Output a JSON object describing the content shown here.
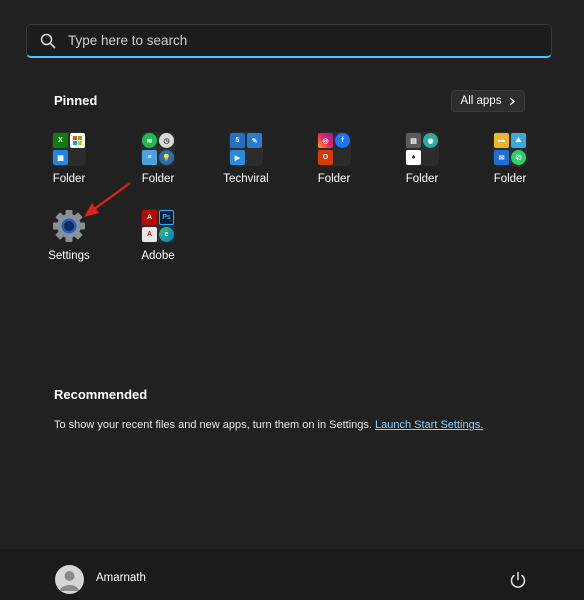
{
  "search": {
    "placeholder": "Type here to search",
    "icon": "search-icon"
  },
  "pinned": {
    "title": "Pinned",
    "all_apps_label": "All apps",
    "apps": [
      {
        "label": "Folder",
        "icons": [
          "xbox-icon",
          "store-icon",
          "calendar-icon",
          "blank"
        ]
      },
      {
        "label": "Folder",
        "icons": [
          "spotify-icon",
          "clock-icon",
          "notepad-icon",
          "tips-icon"
        ]
      },
      {
        "label": "Techviral",
        "icons": [
          "html-icon",
          "pen-icon",
          "media-player-icon",
          "blank"
        ]
      },
      {
        "label": "Folder",
        "icons": [
          "instagram-icon",
          "facebook-icon",
          "office-icon",
          "blank"
        ]
      },
      {
        "label": "Folder",
        "icons": [
          "calculator-icon",
          "maps-icon",
          "solitaire-icon",
          "blank"
        ]
      },
      {
        "label": "Folder",
        "icons": [
          "file-explorer-icon",
          "photos-icon",
          "mail-icon",
          "whatsapp-icon"
        ]
      },
      {
        "label": "Settings",
        "icons": [
          "gear-icon"
        ]
      },
      {
        "label": "Adobe",
        "icons": [
          "acrobat-icon",
          "photoshop-icon",
          "adobe-reader-icon",
          "edge-icon"
        ]
      }
    ]
  },
  "recommended": {
    "title": "Recommended",
    "text": "To show your recent files and new apps, turn them on in Settings. ",
    "link": "Launch Start Settings."
  },
  "user": {
    "name": "Amarnath",
    "avatar_icon": "user-avatar-icon",
    "power_icon": "power-icon"
  },
  "colors": {
    "accent": "#4cc2ff",
    "background": "#212121",
    "link": "#8ed3ff",
    "annotation_arrow": "#e0201a"
  }
}
